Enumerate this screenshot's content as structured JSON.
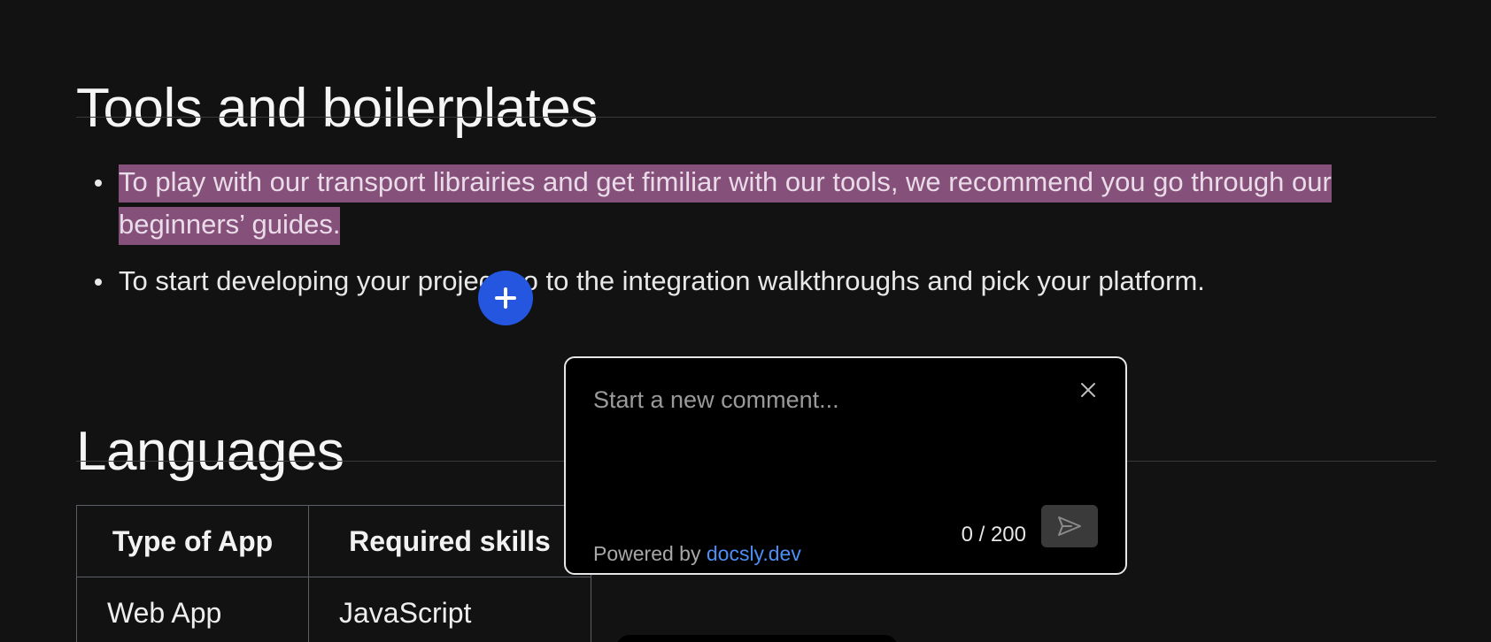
{
  "sections": {
    "tools_title": "Tools and boilerplates",
    "languages_title": "Languages"
  },
  "bullets": [
    "To play with our transport librairies and get fimiliar with our tools, we recommend you go through our beginners’ guides.",
    "To start developing your project go to the integration walkthroughs and pick your platform."
  ],
  "highlight_color": "#85507a",
  "add_comment_button": {
    "icon": "plus-icon",
    "color": "#2456e0"
  },
  "table": {
    "headers": [
      "Type of App",
      "Required skills"
    ],
    "rows": [
      [
        "Web App",
        "JavaScript"
      ]
    ]
  },
  "comment_popup": {
    "placeholder": "Start a new comment...",
    "value": "",
    "counter": "0 / 200",
    "powered_by": "Powered by",
    "powered_link": "docsly.dev",
    "close_icon": "close-icon",
    "send_icon": "send-icon"
  }
}
